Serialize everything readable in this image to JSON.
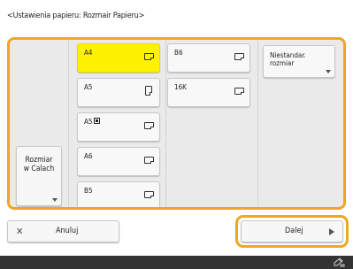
{
  "header": {
    "title": "<Ustawienia papieru: Rozmair Papieru>"
  },
  "side_button": {
    "label": "Rozmiar\nw Calach"
  },
  "paper_sizes": [
    {
      "label": "A4",
      "orientation": "landscape",
      "selected": true
    },
    {
      "label": "A5",
      "orientation": "portrait",
      "selected": false
    },
    {
      "label": "A5",
      "orientation": "landscape",
      "selected": false,
      "has_box_icon": true
    },
    {
      "label": "A6",
      "orientation": "landscape",
      "selected": false
    },
    {
      "label": "B5",
      "orientation": "landscape",
      "selected": false
    },
    {
      "label": "B6",
      "orientation": "landscape",
      "selected": false
    },
    {
      "label": "16K",
      "orientation": "landscape",
      "selected": false
    }
  ],
  "custom_button": {
    "label": "Niestandar.\nrozmiar"
  },
  "footer": {
    "cancel_label": "Anuluj",
    "next_label": "Dalej"
  },
  "colors": {
    "highlight": "#f0a524",
    "selected": "#fff200",
    "statusbar": "#333333"
  },
  "icons": [
    "close-icon",
    "arrow-right-icon",
    "pencil-icon",
    "landscape-paper-icon",
    "portrait-paper-icon"
  ]
}
